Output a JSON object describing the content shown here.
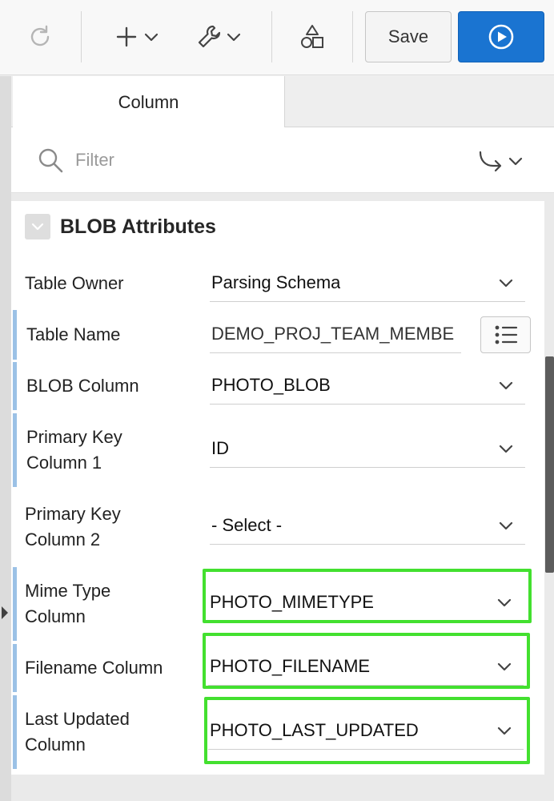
{
  "toolbar": {
    "refresh_icon": "refresh-icon",
    "add_icon": "plus-icon",
    "utilities_icon": "wrench-icon",
    "shared_components_icon": "shapes-icon",
    "save_label": "Save",
    "run_icon": "play-icon"
  },
  "tabs": [
    {
      "label": "Column",
      "active": true
    }
  ],
  "filter": {
    "placeholder": "Filter"
  },
  "section": {
    "title": "BLOB Attributes"
  },
  "fields": [
    {
      "label_line1": "Table Owner",
      "label_line2": "",
      "value": "Parsing Schema",
      "required": false,
      "highlighted": false
    },
    {
      "label_line1": "Table Name",
      "label_line2": "",
      "value": "DEMO_PROJ_TEAM_MEMBE",
      "required": true,
      "highlighted": false
    },
    {
      "label_line1": "BLOB Column",
      "label_line2": "",
      "value": "PHOTO_BLOB",
      "required": true,
      "highlighted": false
    },
    {
      "label_line1": "Primary Key",
      "label_line2": "Column 1",
      "value": "ID",
      "required": true,
      "highlighted": false
    },
    {
      "label_line1": "Primary Key",
      "label_line2": "Column 2",
      "value": "- Select -",
      "required": false,
      "highlighted": false
    },
    {
      "label_line1": "Mime Type",
      "label_line2": "Column",
      "value": "PHOTO_MIMETYPE",
      "required": true,
      "highlighted": true
    },
    {
      "label_line1": "Filename Column",
      "label_line2": "",
      "value": "PHOTO_FILENAME",
      "required": true,
      "highlighted": true
    },
    {
      "label_line1": "Last Updated",
      "label_line2": "Column",
      "value": "PHOTO_LAST_UPDATED",
      "required": true,
      "highlighted": true
    }
  ],
  "colors": {
    "accent": "#1a74d1",
    "required_marker": "#9bc1e6",
    "highlight": "#43e02f"
  }
}
